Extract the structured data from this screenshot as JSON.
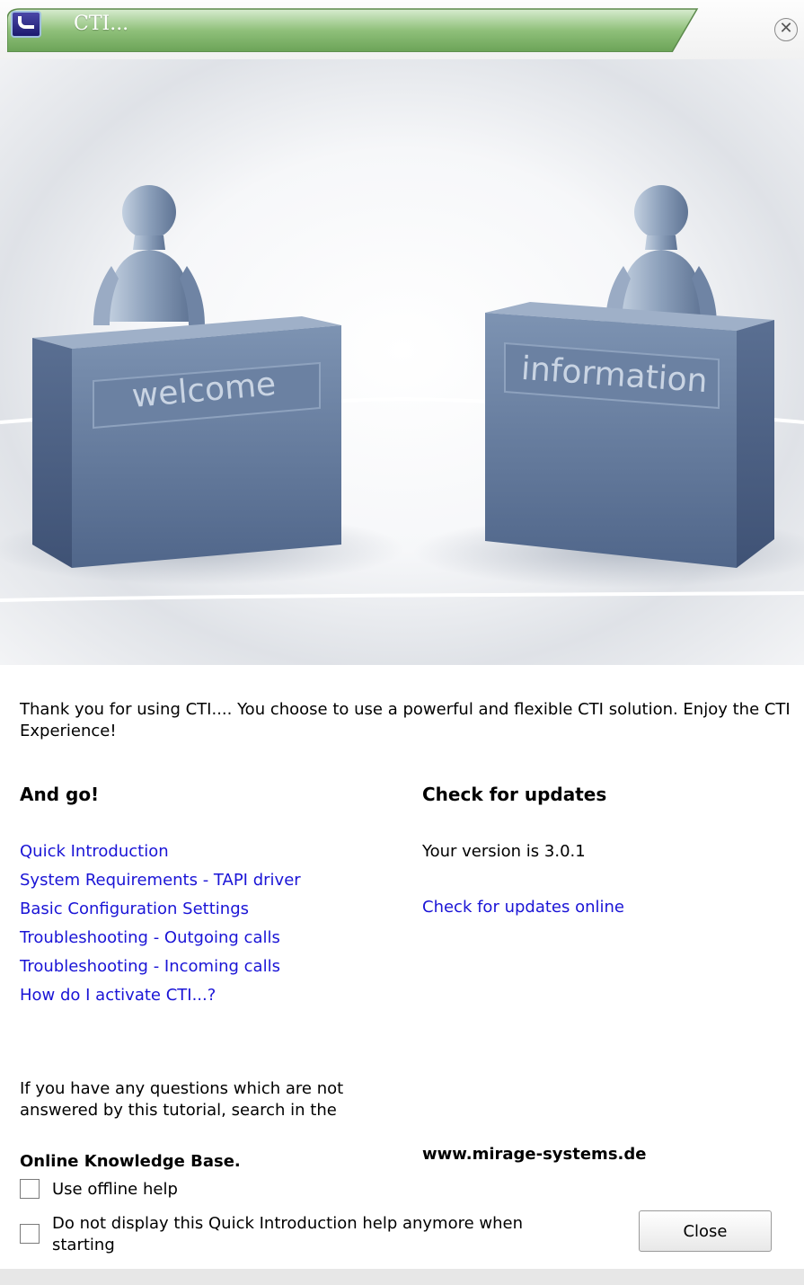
{
  "window": {
    "title": "CTI...",
    "close_symbol": "✕",
    "accent_color": "#7db06a"
  },
  "hero": {
    "left_desk_label": "welcome",
    "right_desk_label": "information"
  },
  "intro_text": "Thank you for using CTI.... You choose to use a powerful and flexible CTI solution. Enjoy the CTI Experience!",
  "left_column": {
    "heading": "And go!",
    "links": [
      "Quick Introduction",
      "System Requirements - TAPI driver",
      "Basic Configuration Settings",
      "Troubleshooting - Outgoing calls",
      "Troubleshooting - Incoming calls",
      "How do I activate CTI...?"
    ],
    "question_text": "If you have any questions which are not answered by this tutorial, search in the",
    "knowledge_base": "Online Knowledge Base."
  },
  "right_column": {
    "heading": "Check for updates",
    "version_text": "Your version is 3.0.1",
    "update_link": "Check for updates online",
    "website": "www.mirage-systems.de"
  },
  "options": {
    "offline_help": {
      "label": "Use offline help",
      "checked": false
    },
    "do_not_display": {
      "label": "Do not display this Quick Introduction help anymore when starting",
      "checked": false
    }
  },
  "close_button": "Close",
  "link_color": "#1a14d6"
}
